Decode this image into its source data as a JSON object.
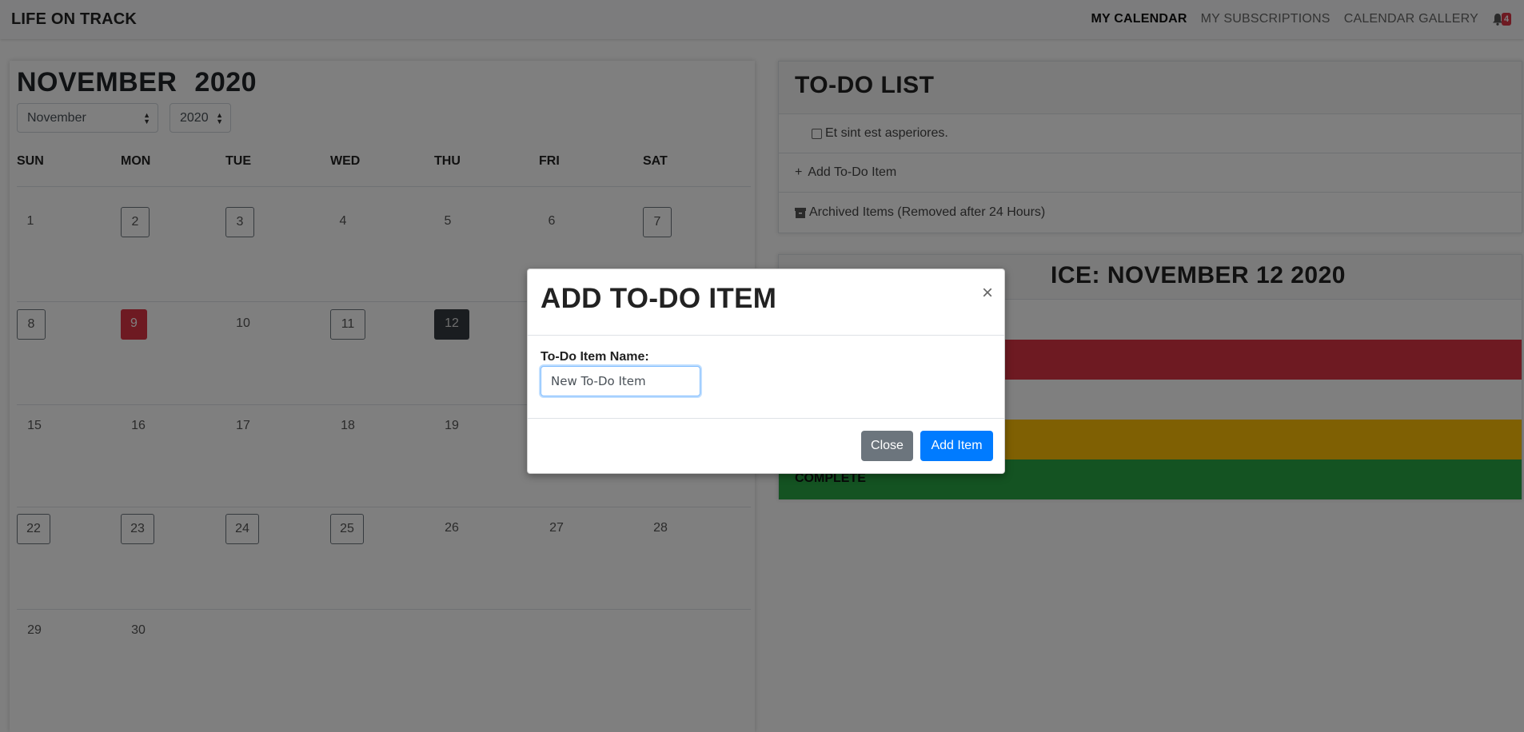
{
  "navbar": {
    "brand": "LIFE ON TRACK",
    "links": [
      "MY CALENDAR",
      "MY SUBSCRIPTIONS",
      "CALENDAR GALLERY"
    ],
    "notification_count": "4"
  },
  "calendar": {
    "month_title": "NOVEMBER",
    "year_title": "2020",
    "month_select": "November",
    "year_select": "2020",
    "weekdays": [
      "SUN",
      "MON",
      "TUE",
      "WED",
      "THU",
      "FRI",
      "SAT"
    ],
    "weeks": [
      [
        "1",
        "2",
        "3",
        "4",
        "5",
        "6",
        "7"
      ],
      [
        "8",
        "9",
        "10",
        "11",
        "12",
        "",
        ""
      ],
      [
        "15",
        "16",
        "17",
        "18",
        "19",
        "",
        ""
      ],
      [
        "22",
        "23",
        "24",
        "25",
        "26",
        "27",
        "28"
      ],
      [
        "29",
        "30",
        "",
        "",
        "",
        "",
        ""
      ]
    ]
  },
  "todo": {
    "title": "TO-DO LIST",
    "item": "Et sint est asperiores.",
    "add_label": "Add To-Do Item",
    "archived_label": "Archived Items (Removed after 24 Hours)"
  },
  "status": {
    "title_visible": "ICE: NOVEMBER 12 2020",
    "complete_label": "COMPLETE",
    "colors": {
      "red": "#dc3545",
      "yellow": "#ffc107",
      "green": "#28a745"
    }
  },
  "modal": {
    "title": "ADD TO-DO ITEM",
    "field_label": "To-Do Item Name:",
    "field_value": "New To-Do Item",
    "close_label": "Close",
    "add_label": "Add Item"
  }
}
